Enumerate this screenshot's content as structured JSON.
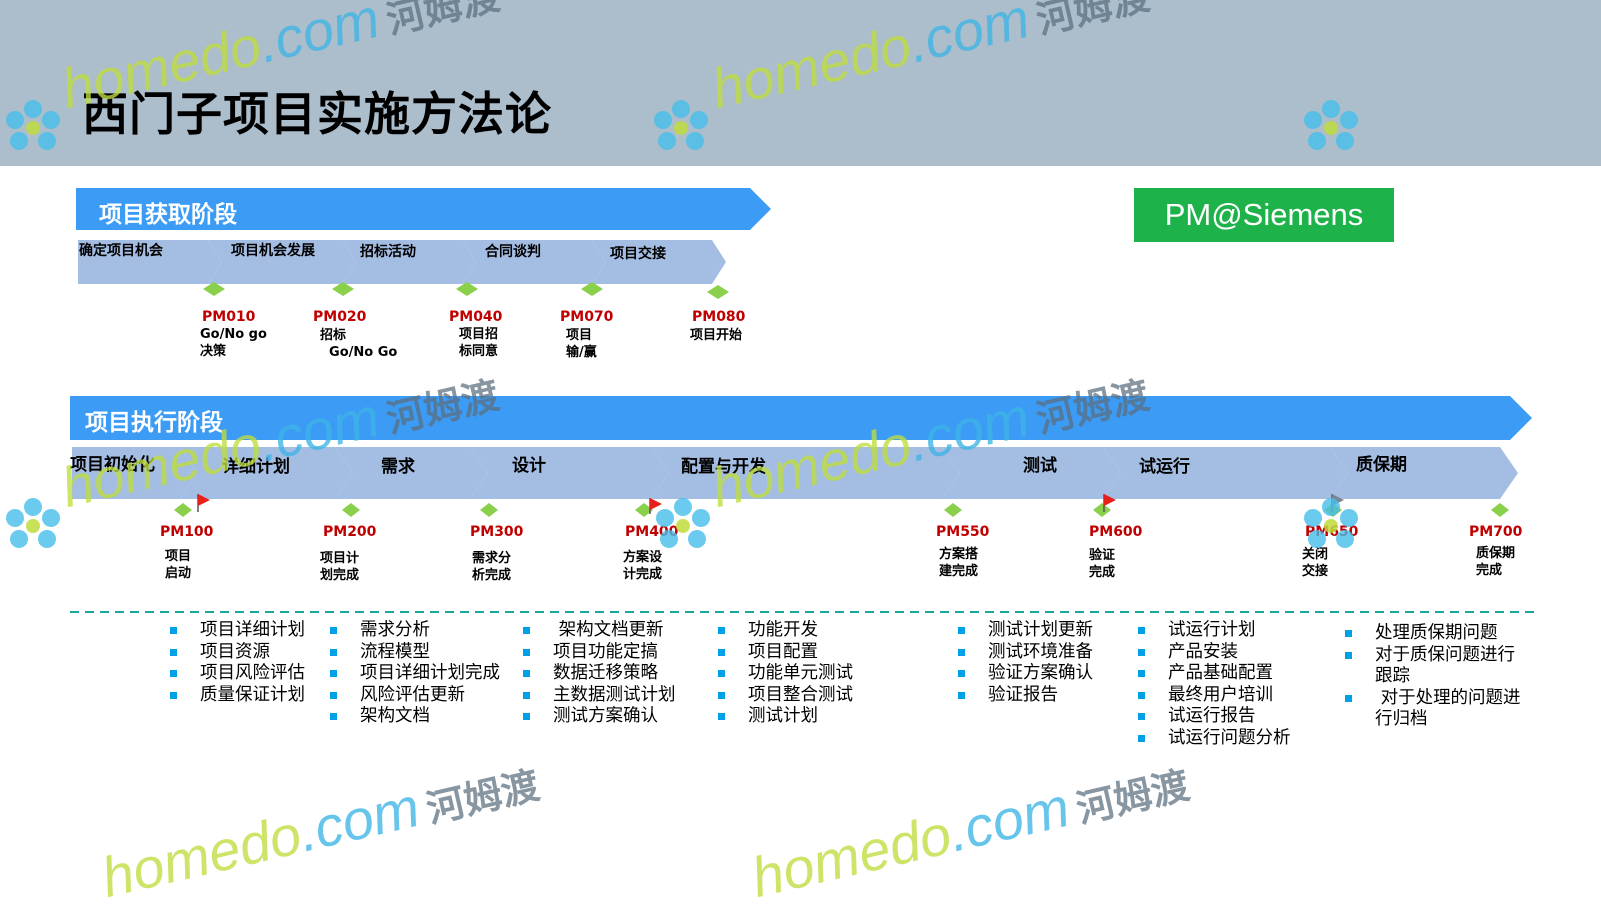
{
  "title": "西门子项目实施方法论",
  "badge": "PM@Siemens",
  "acquisition": {
    "title": "项目获取阶段",
    "steps": [
      "确定项目机会",
      "项目机会发展",
      "招标活动",
      "合同谈判",
      "项目交接"
    ],
    "milestones": [
      {
        "code": "PM010",
        "desc": "Go/No go\n决策"
      },
      {
        "code": "PM020",
        "desc": "招标\n  Go/No Go"
      },
      {
        "code": "PM040",
        "desc": "项目招\n标同意"
      },
      {
        "code": "PM070",
        "desc": "项目\n输/赢"
      },
      {
        "code": "PM080",
        "desc": "项目开始"
      }
    ]
  },
  "execution": {
    "title": "项目执行阶段",
    "steps": [
      "项目初始化",
      "详细计划",
      "需求",
      "设计",
      "配置与开发",
      "测试",
      "试运行",
      "质保期"
    ],
    "milestones": [
      {
        "code": "PM100",
        "desc": "项目\n启动"
      },
      {
        "code": "PM200",
        "desc": "项目计\n划完成"
      },
      {
        "code": "PM300",
        "desc": "需求分\n析完成"
      },
      {
        "code": "PM400",
        "desc": "方案设\n计完成"
      },
      {
        "code": "PM550",
        "desc": "方案搭\n建完成"
      },
      {
        "code": "PM600",
        "desc": "验证\n完成"
      },
      {
        "code": "PM650",
        "desc": "关闭\n交接"
      },
      {
        "code": "PM700",
        "desc": "质保期\n完成"
      }
    ]
  },
  "tasks": [
    [
      "项目详细计划",
      "项目资源",
      "项目风险评估",
      "质量保证计划"
    ],
    [
      "需求分析",
      "流程模型",
      "项目详细计划完成",
      "风险评估更新",
      "架构文档"
    ],
    [
      " 架构文档更新",
      "项目功能定搞",
      "数据迁移策略",
      "主数据测试计划",
      "测试方案确认"
    ],
    [
      "功能开发",
      "项目配置",
      "功能单元测试",
      "项目整合测试",
      "测试计划"
    ],
    [
      "测试计划更新",
      "测试环境准备",
      "验证方案确认",
      "验证报告"
    ],
    [
      "试运行计划",
      "产品安装",
      "产品基础配置",
      "最终用户培训",
      "试运行报告",
      "试运行问题分析"
    ],
    [
      "处理质保期问题",
      "对于质保问题进行\n跟踪",
      " 对于处理的问题进\n行归档"
    ]
  ],
  "watermark": {
    "domain_main": "homedo",
    "domain_suffix": ".com",
    "cn": "河姆渡"
  },
  "colors": {
    "header": "#acbdcb",
    "phase_arrow": "#3c9cf5",
    "step_chevron": "#a4bde3",
    "milestone_diamond": "#8ad04a",
    "code_red": "#c00000",
    "badge": "#1eb34a",
    "bullet": "#00a0e6"
  }
}
